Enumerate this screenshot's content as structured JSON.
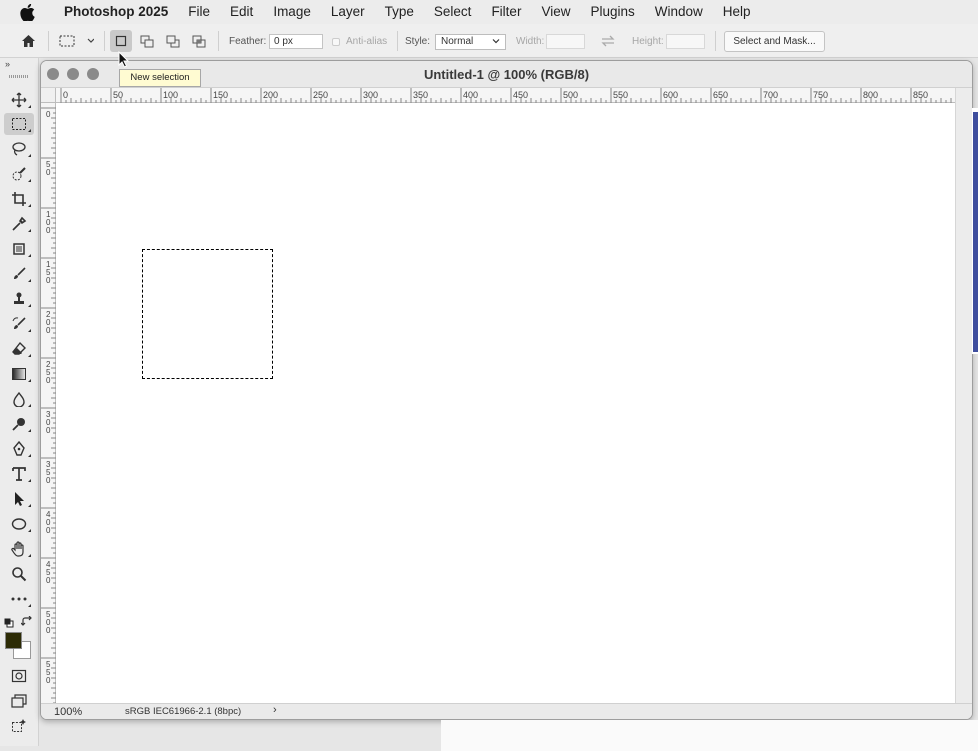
{
  "menubar": {
    "app_name": "Photoshop 2025",
    "items": [
      "File",
      "Edit",
      "Image",
      "Layer",
      "Type",
      "Select",
      "Filter",
      "View",
      "Plugins",
      "Window",
      "Help"
    ]
  },
  "options_bar": {
    "feather_label": "Feather:",
    "feather_value": "0 px",
    "anti_alias_label": "Anti-alias",
    "style_label": "Style:",
    "style_value": "Normal",
    "width_label": "Width:",
    "width_value": "",
    "height_label": "Height:",
    "height_value": "",
    "select_mask_label": "Select and Mask..."
  },
  "tooltip": {
    "text": "New selection"
  },
  "document": {
    "title": "Untitled-1 @ 100% (RGB/8)",
    "zoom": "100%",
    "color_profile": "sRGB IEC61966-2.1 (8bpc)",
    "status_arrow": "›"
  },
  "rulers": {
    "horizontal": [
      "0",
      "50",
      "100",
      "150",
      "200",
      "250",
      "300",
      "350",
      "400",
      "450",
      "500",
      "550",
      "600",
      "650",
      "700",
      "750",
      "800",
      "850"
    ],
    "vertical": [
      "0",
      "50",
      "100",
      "150",
      "200",
      "250",
      "300",
      "350",
      "400",
      "450",
      "500",
      "550"
    ]
  },
  "colors": {
    "foreground": "#2c2b05",
    "background": "#ffffff"
  }
}
